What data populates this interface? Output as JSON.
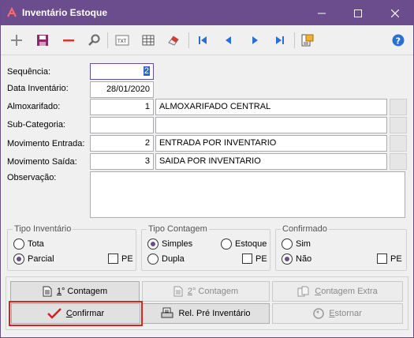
{
  "window": {
    "title": "Inventário Estoque",
    "title_color": "#6b4d8e",
    "controls": {
      "minimize": "—",
      "maximize": "☐",
      "close": "✕"
    }
  },
  "toolbar": {
    "icons": [
      "plus-icon",
      "save-icon",
      "minus-icon",
      "search-icon",
      "text-export-icon",
      "table-icon",
      "eraser-icon",
      "first-record-icon",
      "previous-record-icon",
      "next-record-icon",
      "last-record-icon",
      "report-icon",
      "help-icon"
    ],
    "help_label": "?"
  },
  "form": {
    "sequencia": {
      "label": "Sequência:",
      "value": "2"
    },
    "data_inventario": {
      "label": "Data Inventário:",
      "value": "28/01/2020"
    },
    "almoxarifado": {
      "label": "Almoxarifado:",
      "code": "1",
      "description": "ALMOXARIFADO CENTRAL"
    },
    "sub_categoria": {
      "label": "Sub-Categoria:",
      "code": "",
      "description": ""
    },
    "movimento_entrada": {
      "label": "Movimento Entrada:",
      "code": "2",
      "description": "ENTRADA POR INVENTARIO"
    },
    "movimento_saida": {
      "label": "Movimento Saída:",
      "code": "3",
      "description": "SAIDA POR INVENTARIO"
    },
    "observacao": {
      "label": "Observação:",
      "value": ""
    }
  },
  "tipo_inventario": {
    "title": "Tipo Inventário",
    "options": [
      {
        "label": "Tota",
        "selected": false
      },
      {
        "label": "Parcial",
        "selected": true
      }
    ],
    "pe_label": "PE",
    "pe_checked": false
  },
  "tipo_contagem": {
    "title": "Tipo Contagem",
    "options": [
      {
        "label": "Simples",
        "selected": true
      },
      {
        "label": "Estoque",
        "selected": false
      },
      {
        "label": "Dupla",
        "selected": false
      }
    ],
    "pe_label": "PE",
    "pe_checked": false
  },
  "confirmado": {
    "title": "Confirmado",
    "options": [
      {
        "label": "Sim",
        "selected": false
      },
      {
        "label": "Não",
        "selected": true
      }
    ],
    "pe_label": "PE",
    "pe_checked": false
  },
  "buttons": {
    "contagem1": {
      "mnemonic": "1",
      "rest": "° Contagem",
      "enabled": true
    },
    "contagem2": {
      "mnemonic": "2",
      "rest": "° Contagem",
      "enabled": false
    },
    "contagem_extra": {
      "mnemonic": "C",
      "rest": "ontagem Extra",
      "enabled": false
    },
    "confirmar": {
      "mnemonic": "C",
      "rest": "onfirmar",
      "enabled": true
    },
    "rel_pre_inventario": {
      "label": "Rel. Pré Inventário",
      "enabled": true
    },
    "estornar": {
      "mnemonic": "E",
      "rest": "stornar",
      "enabled": false
    }
  },
  "colors": {
    "accent": "#6b4d8e",
    "highlight_border": "#e02020",
    "nav_blue": "#2a6fd6",
    "minus_red": "#d83a2a"
  }
}
